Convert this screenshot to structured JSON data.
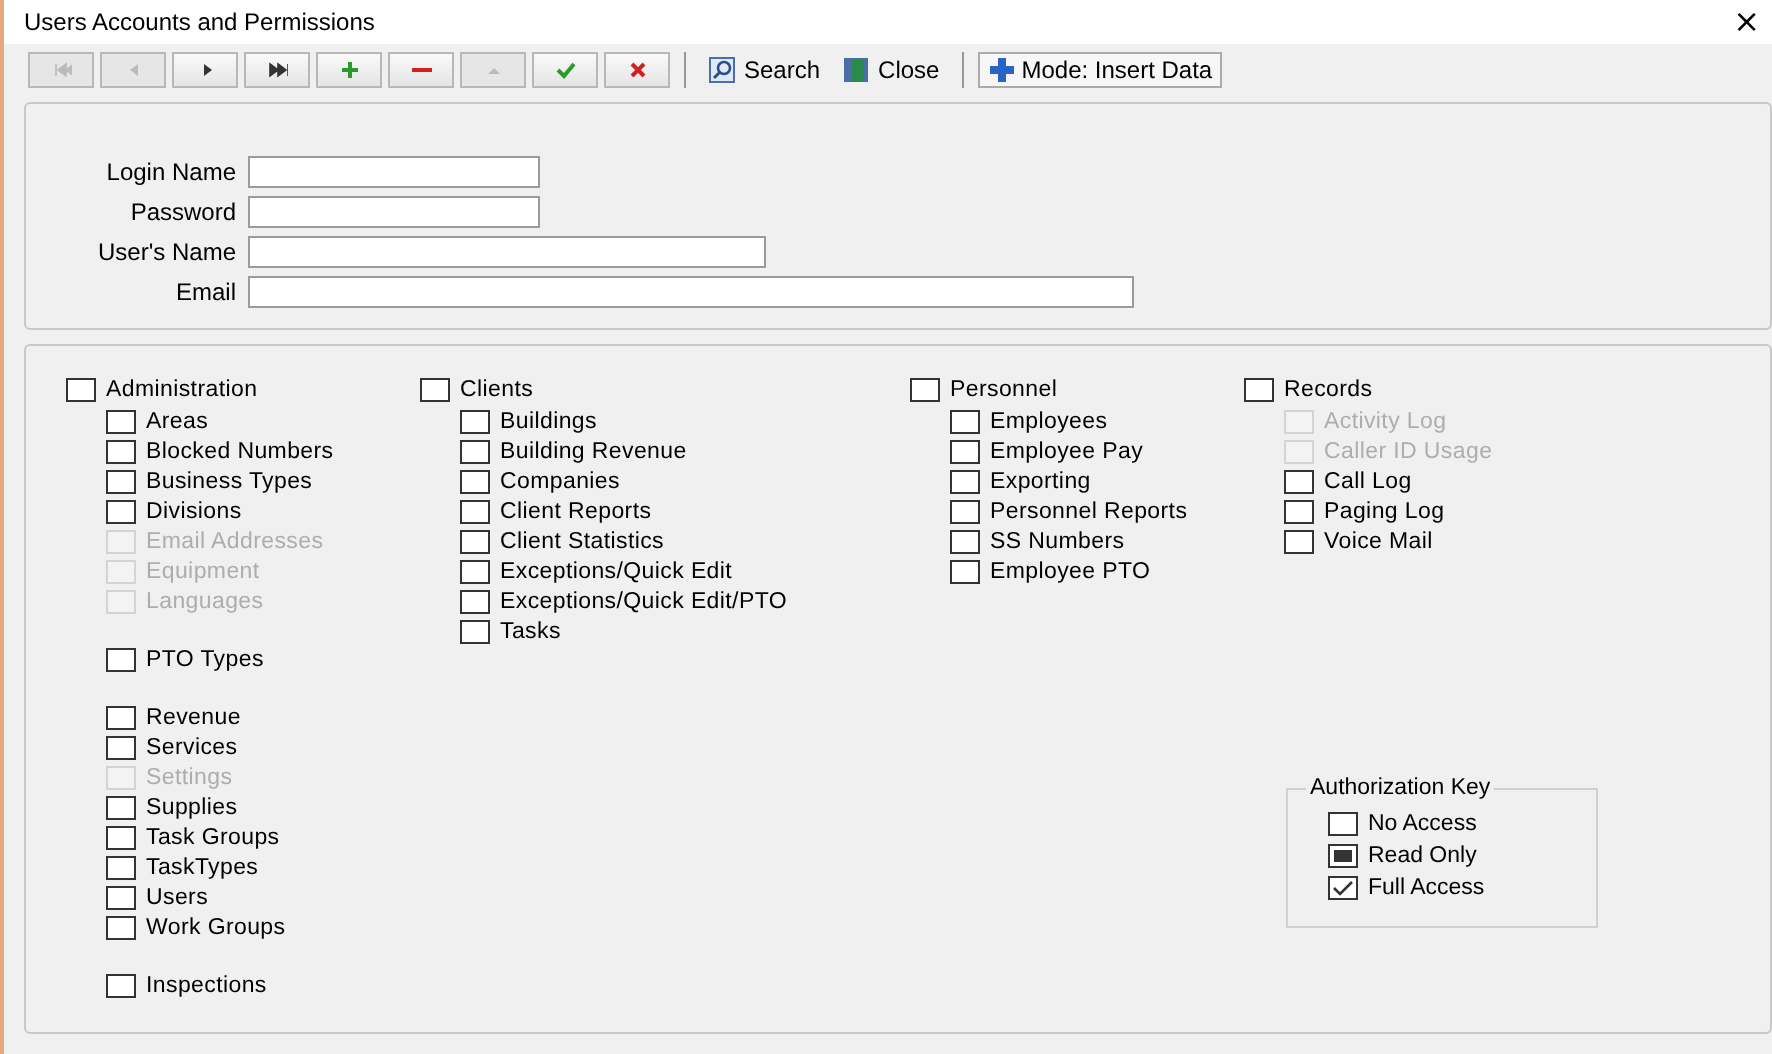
{
  "window": {
    "title": "Users Accounts and Permissions",
    "close": "×"
  },
  "toolbar": {
    "nav": [
      {
        "kind": "first",
        "disabled": true
      },
      {
        "kind": "prev",
        "disabled": true
      },
      {
        "kind": "next",
        "disabled": false
      },
      {
        "kind": "last",
        "disabled": false
      },
      {
        "kind": "add",
        "disabled": false
      },
      {
        "kind": "delete",
        "disabled": false
      },
      {
        "kind": "up",
        "disabled": true
      },
      {
        "kind": "save",
        "disabled": false
      },
      {
        "kind": "cancel",
        "disabled": false
      }
    ],
    "actions": [
      {
        "kind": "search",
        "label": "Search"
      },
      {
        "kind": "close",
        "label": "Close"
      }
    ],
    "mode": {
      "label": "Mode: Insert Data"
    }
  },
  "form": {
    "fields": [
      {
        "label": "Login Name"
      },
      {
        "label": "Password"
      },
      {
        "label": "User's Name"
      },
      {
        "label": "Email"
      }
    ]
  },
  "permissions": [
    {
      "label": "Administration",
      "checked": false,
      "sections": [
        {
          "items": [
            {
              "label": "Areas",
              "checked": false,
              "disabled": false
            },
            {
              "label": "Blocked Numbers",
              "checked": false,
              "disabled": false
            },
            {
              "label": "Business Types",
              "checked": false,
              "disabled": false
            },
            {
              "label": "Divisions",
              "checked": false,
              "disabled": false
            },
            {
              "label": "Email Addresses",
              "checked": false,
              "disabled": true
            },
            {
              "label": "Equipment",
              "checked": false,
              "disabled": true
            },
            {
              "label": "Languages",
              "checked": false,
              "disabled": true
            }
          ]
        },
        {
          "items": [
            {
              "label": "PTO Types",
              "checked": false,
              "disabled": false
            }
          ]
        },
        {
          "items": [
            {
              "label": "Revenue",
              "checked": false,
              "disabled": false
            },
            {
              "label": "Services",
              "checked": false,
              "disabled": false
            },
            {
              "label": "Settings",
              "checked": false,
              "disabled": true
            },
            {
              "label": "Supplies",
              "checked": false,
              "disabled": false
            },
            {
              "label": "Task Groups",
              "checked": false,
              "disabled": false
            },
            {
              "label": "TaskTypes",
              "checked": false,
              "disabled": false
            },
            {
              "label": "Users",
              "checked": false,
              "disabled": false
            },
            {
              "label": "Work Groups",
              "checked": false,
              "disabled": false
            }
          ]
        },
        {
          "items": [
            {
              "label": "Inspections",
              "checked": false,
              "disabled": false
            }
          ]
        }
      ]
    },
    {
      "label": "Clients",
      "checked": false,
      "sections": [
        {
          "items": [
            {
              "label": "Buildings",
              "checked": false,
              "disabled": false
            },
            {
              "label": "Building Revenue",
              "checked": false,
              "disabled": false
            },
            {
              "label": "Companies",
              "checked": false,
              "disabled": false
            },
            {
              "label": "Client Reports",
              "checked": false,
              "disabled": false
            },
            {
              "label": "Client Statistics",
              "checked": false,
              "disabled": false
            },
            {
              "label": "Exceptions/Quick Edit",
              "checked": false,
              "disabled": false
            },
            {
              "label": "Exceptions/Quick Edit/PTO",
              "checked": false,
              "disabled": false
            },
            {
              "label": "Tasks",
              "checked": false,
              "disabled": false
            }
          ]
        }
      ]
    },
    {
      "label": "Personnel",
      "checked": false,
      "sections": [
        {
          "items": [
            {
              "label": "Employees",
              "checked": false,
              "disabled": false
            },
            {
              "label": "Employee Pay",
              "checked": false,
              "disabled": false
            },
            {
              "label": "Exporting",
              "checked": false,
              "disabled": false
            },
            {
              "label": "Personnel Reports",
              "checked": false,
              "disabled": false
            },
            {
              "label": "SS Numbers",
              "checked": false,
              "disabled": false
            },
            {
              "label": "Employee PTO",
              "checked": false,
              "disabled": false
            }
          ]
        }
      ]
    },
    {
      "label": "Records",
      "checked": false,
      "sections": [
        {
          "items": [
            {
              "label": "Activity Log",
              "checked": false,
              "disabled": true
            },
            {
              "label": "Caller ID Usage",
              "checked": false,
              "disabled": true
            },
            {
              "label": "Call Log",
              "checked": false,
              "disabled": false
            },
            {
              "label": "Paging Log",
              "checked": false,
              "disabled": false
            },
            {
              "label": "Voice Mail",
              "checked": false,
              "disabled": false
            }
          ]
        }
      ]
    }
  ],
  "authorization_key": {
    "title": "Authorization Key",
    "items": [
      {
        "kind": "none",
        "label": "No Access"
      },
      {
        "kind": "read",
        "label": "Read Only"
      },
      {
        "kind": "full",
        "label": "Full Access"
      }
    ]
  }
}
